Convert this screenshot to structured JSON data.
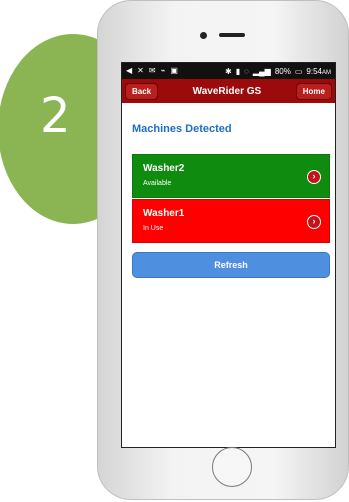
{
  "step": {
    "number": "2"
  },
  "status_bar": {
    "battery": "80%",
    "time": "9:54",
    "ampm": "AM"
  },
  "nav": {
    "back_label": "Back",
    "title": "WaveRider GS",
    "home_label": "Home"
  },
  "section": {
    "title": "Machines Detected"
  },
  "machines": [
    {
      "name": "Washer2",
      "status": "Available"
    },
    {
      "name": "Washer1",
      "status": "In Use"
    }
  ],
  "actions": {
    "refresh_label": "Refresh"
  }
}
